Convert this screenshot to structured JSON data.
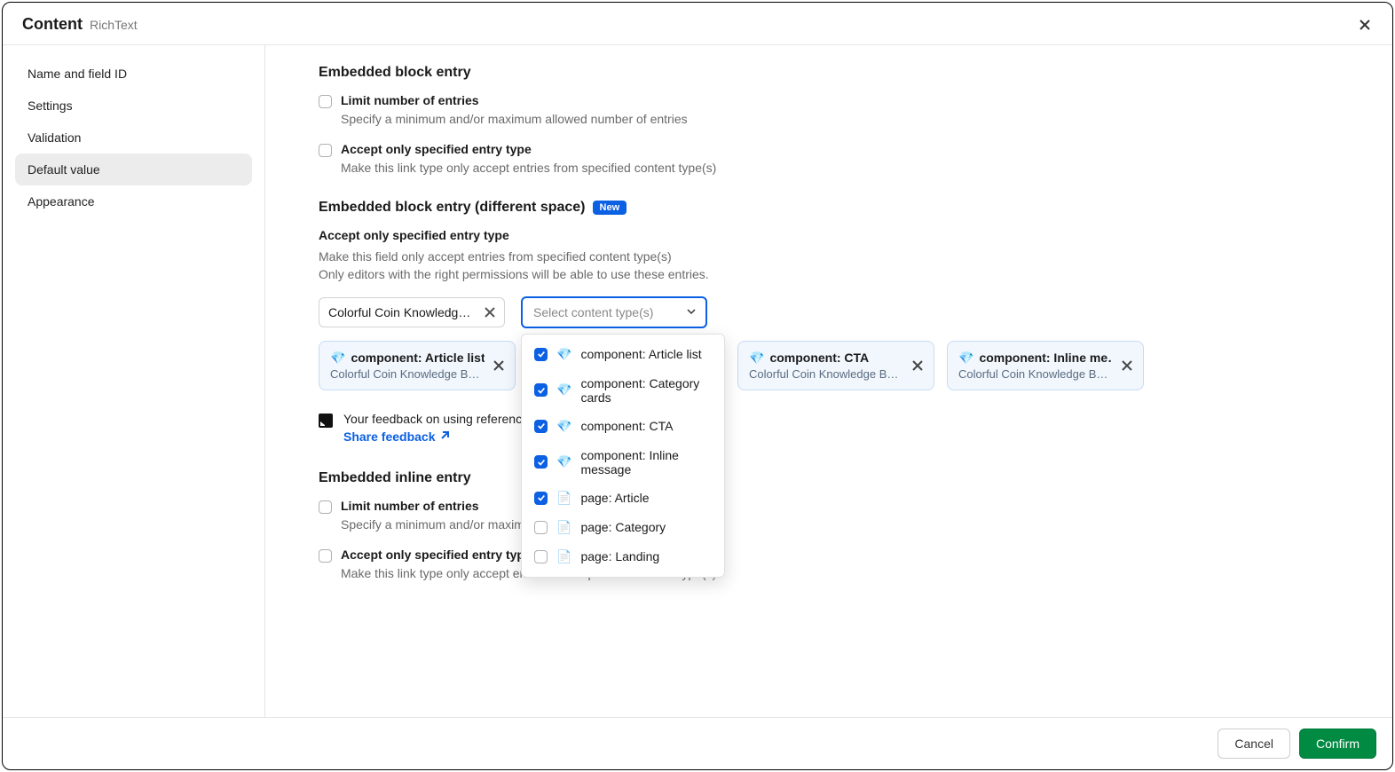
{
  "header": {
    "title": "Content",
    "subtitle": "RichText"
  },
  "sidebar": {
    "items": [
      {
        "label": "Name and field ID",
        "active": false
      },
      {
        "label": "Settings",
        "active": false
      },
      {
        "label": "Validation",
        "active": false
      },
      {
        "label": "Default value",
        "active": true
      },
      {
        "label": "Appearance",
        "active": false
      }
    ]
  },
  "sections": {
    "s1_title": "Embedded block entry",
    "s1_cb1_label": "Limit number of entries",
    "s1_cb1_desc": "Specify a minimum and/or maximum allowed number of entries",
    "s1_cb2_label": "Accept only specified entry type",
    "s1_cb2_desc": "Make this link type only accept entries from specified content type(s)",
    "s2_title": "Embedded block entry (different space)",
    "s2_badge": "New",
    "s2_sub_label": "Accept only specified entry type",
    "s2_sub_desc1": "Make this field only accept entries from specified content type(s)",
    "s2_sub_desc2": "Only editors with the right permissions will be able to use these entries.",
    "s3_title": "Embedded inline entry",
    "s3_cb1_label": "Limit number of entries",
    "s3_cb1_desc": "Specify a minimum and/or maximum allowed number of entries",
    "s3_cb2_label": "Accept only specified entry type",
    "s3_cb2_desc": "Make this link type only accept entries from specified content type(s)"
  },
  "space_chip": "Colorful Coin Knowledge B…",
  "select_placeholder": "Select content type(s)",
  "dropdown": [
    {
      "emoji": "💎",
      "label": "component: Article list",
      "checked": true
    },
    {
      "emoji": "💎",
      "label": "component: Category cards",
      "checked": true
    },
    {
      "emoji": "💎",
      "label": "component: CTA",
      "checked": true
    },
    {
      "emoji": "💎",
      "label": "component: Inline message",
      "checked": true
    },
    {
      "emoji": "📄",
      "label": "page: Article",
      "checked": true
    },
    {
      "emoji": "📄",
      "label": "page: Category",
      "checked": false
    },
    {
      "emoji": "📄",
      "label": "page: Landing",
      "checked": false
    }
  ],
  "cards": [
    {
      "emoji": "💎",
      "title": "component: Article list",
      "sub": "Colorful Coin Knowledge Base"
    },
    {
      "emoji": "💎",
      "title": "component: CTA",
      "sub": "Colorful Coin Knowledge Base"
    },
    {
      "emoji": "💎",
      "title": "component: Inline me…",
      "sub": "Colorful Coin Knowledge Base"
    }
  ],
  "feedback": {
    "text": "Your feedback on using references",
    "link": "Share feedback"
  },
  "footer": {
    "cancel": "Cancel",
    "confirm": "Confirm"
  }
}
